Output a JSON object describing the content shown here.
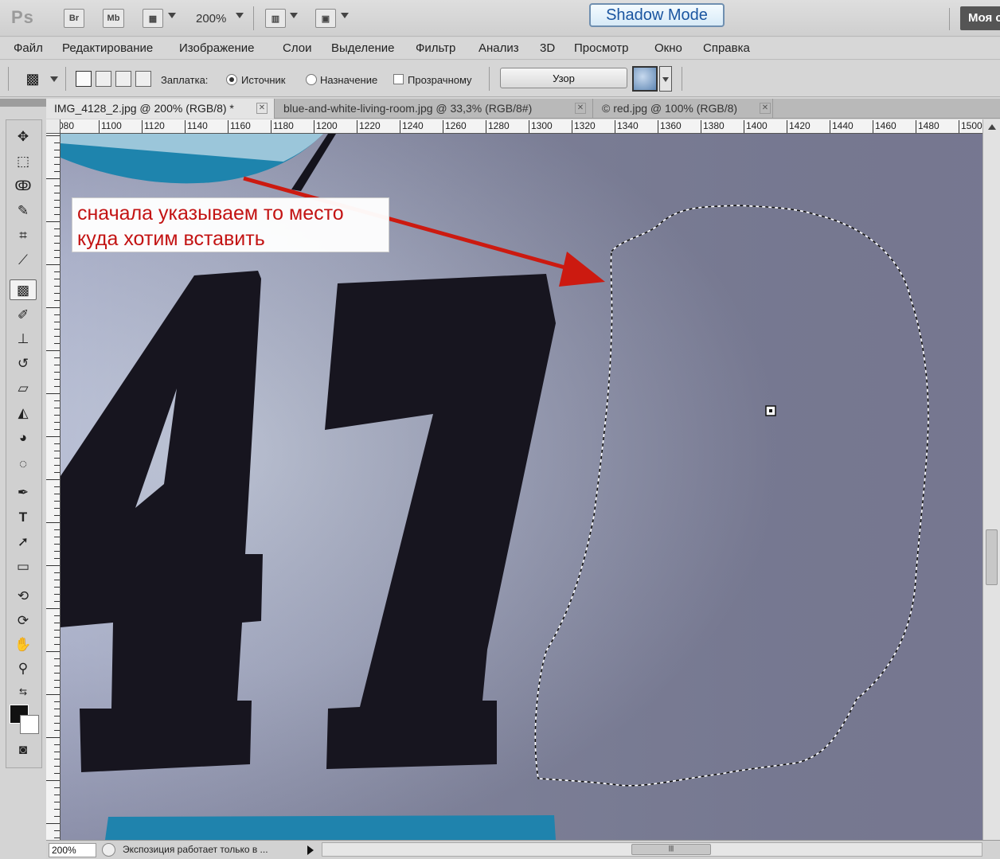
{
  "appbar": {
    "logo": "Ps",
    "bridge_label": "Br",
    "minibridge_label": "Mb",
    "zoom": "200%",
    "shadow_mode": "Shadow Mode",
    "workspace": "Моя с"
  },
  "menu": [
    "Файл",
    "Редактирование",
    "Изображение",
    "Слои",
    "Выделение",
    "Фильтр",
    "Анализ",
    "3D",
    "Просмотр",
    "Окно",
    "Справка"
  ],
  "options": {
    "patch_label": "Заплатка:",
    "source_label": "Источник",
    "destination_label": "Назначение",
    "transparent_label": "Прозрачному",
    "source_selected": true,
    "pattern_button": "Узор"
  },
  "tabs": [
    {
      "title": "IMG_4128_2.jpg @ 200% (RGB/8) *",
      "active": true
    },
    {
      "title": "blue-and-white-living-room.jpg @ 33,3% (RGB/8#)",
      "active": false
    },
    {
      "title": "© red.jpg @ 100% (RGB/8)",
      "active": false
    }
  ],
  "tools": [
    "move-icon",
    "marquee-icon",
    "lasso-icon",
    "quick-selection-icon",
    "crop-icon",
    "eyedropper-icon",
    "patch-icon",
    "brush-icon",
    "clone-stamp-icon",
    "history-brush-icon",
    "eraser-icon",
    "paint-bucket-icon",
    "dodge-icon",
    "sponge-icon",
    "pen-icon",
    "type-icon",
    "path-selection-icon",
    "rectangle-icon",
    "3d-rotate-icon",
    "3d-orbit-icon",
    "hand-icon",
    "zoom-icon"
  ],
  "ruler_labels": [
    "080",
    "1100",
    "1120",
    "1140",
    "1160",
    "1180",
    "1200",
    "1220",
    "1240",
    "1260",
    "1280",
    "1300",
    "1320",
    "1340",
    "1360",
    "1380",
    "1400",
    "1420",
    "1440",
    "1460",
    "1480",
    "1500"
  ],
  "canvas": {
    "jersey_number": "47"
  },
  "annotation": {
    "line1": "сначала указываем то место",
    "line2": "куда хотим вставить",
    "color": "#c31313"
  },
  "status": {
    "zoom": "200%",
    "text": "Экспозиция работает только в ..."
  },
  "colors": {
    "foreground": "#111111",
    "background": "#ffffff",
    "arrow": "#cc1a10"
  }
}
